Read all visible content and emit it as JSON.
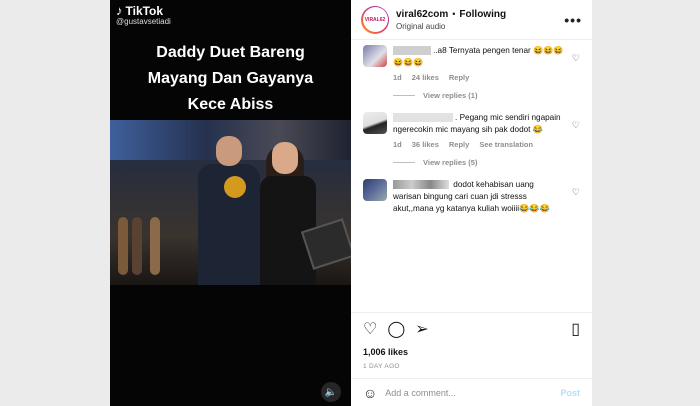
{
  "video": {
    "tiktok_label": "TikTok",
    "tiktok_user": "@gustavsetiadi",
    "caption_lines": [
      "Daddy Duet Bareng",
      "Mayang Dan Gayanya",
      "Kece Abiss"
    ]
  },
  "header": {
    "avatar_text": "VIRAL62",
    "username": "viral62com",
    "separator": "•",
    "follow_label": "Following",
    "audio_label": "Original audio",
    "more_label": "•••"
  },
  "comments": [
    {
      "user_visible": "..a8",
      "text": "Ternyata pengen tenar 😆😆😆😆😆😆",
      "time": "1d",
      "likes": "24 likes",
      "reply": "Reply",
      "translation": "",
      "replies": "View replies (1)"
    },
    {
      "user_visible": ".",
      "text": "Pegang mic sendiri ngapain ngerecokin mic mayang sih pak dodot 😂",
      "time": "1d",
      "likes": "36 likes",
      "reply": "Reply",
      "translation": "See translation",
      "replies": "View replies (5)"
    },
    {
      "user_visible": "",
      "text": "dodot kehabisan uang warisan bingung cari cuan jdi stresss akut,,mana yg katanya kuliah woiiii😂😂😂",
      "time": "",
      "likes": "",
      "reply": "",
      "translation": "",
      "replies": ""
    }
  ],
  "actions": {
    "like_icon": "heart-icon",
    "comment_icon": "comment-icon",
    "share_icon": "share-icon",
    "save_icon": "bookmark-icon"
  },
  "likes_count": "1,006 likes",
  "time_ago": "1 DAY AGO",
  "add_comment": {
    "placeholder": "Add a comment...",
    "post_label": "Post"
  },
  "colors": {
    "link_blue_disabled": "#b2dffc",
    "meta_gray": "#8e8e8e",
    "background": "#ebebeb"
  }
}
